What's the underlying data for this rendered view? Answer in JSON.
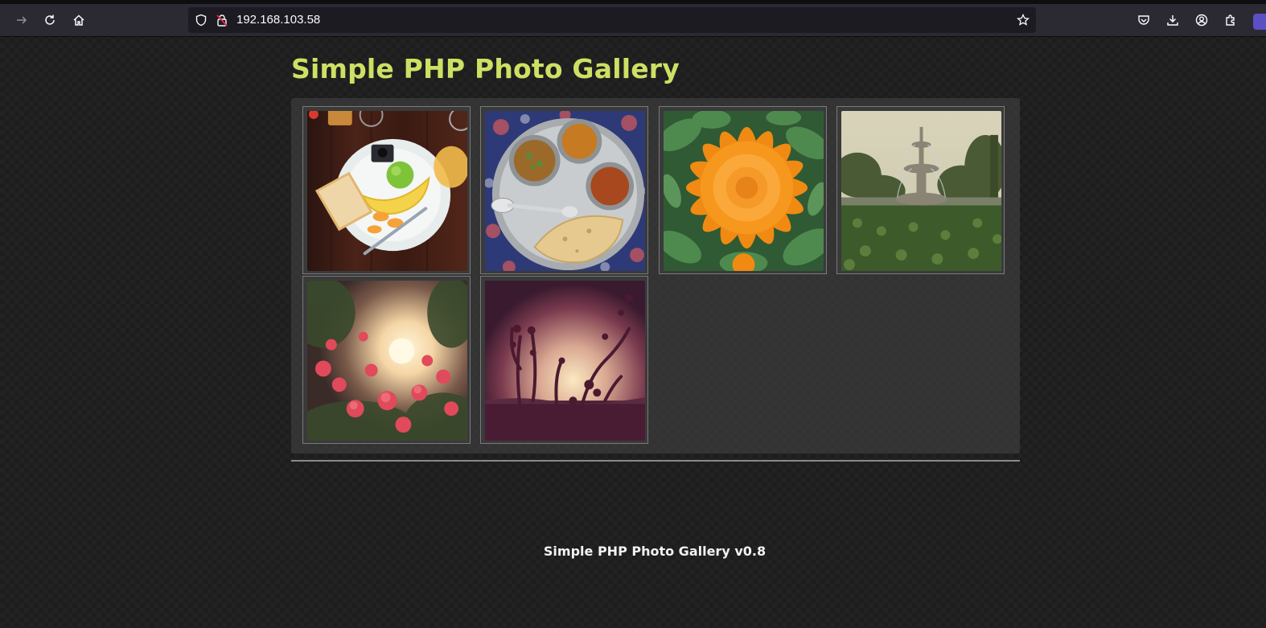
{
  "browser": {
    "url": "192.168.103.58",
    "icons": [
      "forward-icon",
      "reload-icon",
      "home-icon",
      "shield-icon",
      "insecure-lock-icon",
      "bookmark-star-icon",
      "pocket-icon",
      "downloads-icon",
      "account-icon",
      "extensions-icon"
    ]
  },
  "page": {
    "title": "Simple PHP Photo Gallery",
    "footer": "Simple PHP Photo Gallery v0.8",
    "title_color": "#cee063"
  },
  "gallery": {
    "photos": [
      {
        "subject": "breakfast plate with bread, banana and orange slices"
      },
      {
        "subject": "steel thali with curries and chapati"
      },
      {
        "subject": "orange marigold flower"
      },
      {
        "subject": "garden fountain"
      },
      {
        "subject": "pink bougainvillea at sunset"
      },
      {
        "subject": "silhouetted plants against sunset"
      }
    ]
  }
}
